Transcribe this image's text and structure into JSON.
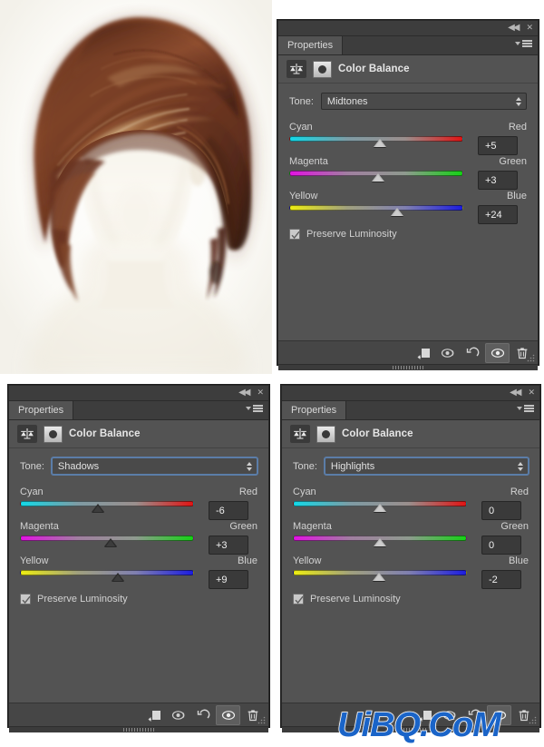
{
  "artwork": {
    "name": "hair-painting-artwork",
    "description": "Digital painting of auburn short hair on a faceless head",
    "colors": {
      "hair_dark": "#4a2418",
      "hair_mid": "#8a4b2e",
      "hair_light": "#d79a63",
      "hair_highlight": "#f2d6a8",
      "skin": "#f6f2ea",
      "background": "#ffffff"
    }
  },
  "watermark": {
    "text": "UiBQ.CoM",
    "color": "#1a64c8"
  },
  "panel_common": {
    "tab_label": "Properties",
    "adjustment_title": "Color Balance",
    "tone_label": "Tone:",
    "preserve_luminosity_label": "Preserve Luminosity",
    "preserve_luminosity_checked": true,
    "sliders": {
      "cyan_red": {
        "left": "Cyan",
        "right": "Red"
      },
      "magenta_green": {
        "left": "Magenta",
        "right": "Green"
      },
      "yellow_blue": {
        "left": "Yellow",
        "right": "Blue"
      }
    },
    "window_buttons": {
      "collapse": "◀◀",
      "close": "✕"
    },
    "footer_buttons": [
      {
        "name": "clip-to-layer-icon",
        "title": "Clip to Layer"
      },
      {
        "name": "view-previous-state-icon",
        "title": "View Previous State"
      },
      {
        "name": "reset-icon",
        "title": "Reset"
      },
      {
        "name": "toggle-visibility-icon",
        "title": "Toggle Layer Visibility"
      },
      {
        "name": "delete-icon",
        "title": "Delete Adjustment Layer"
      }
    ]
  },
  "panels": [
    {
      "id": "midtones",
      "tone_value": "Midtones",
      "tone_focused": false,
      "thumb_style": "light",
      "values": {
        "cyan_red": "+5",
        "magenta_green": "+3",
        "yellow_blue": "+24"
      },
      "slider_percent": {
        "cyan_red": 52,
        "magenta_green": 51,
        "yellow_blue": 62
      },
      "active_footer_index": 3
    },
    {
      "id": "shadows",
      "tone_value": "Shadows",
      "tone_focused": true,
      "thumb_style": "dark",
      "values": {
        "cyan_red": "-6",
        "magenta_green": "+3",
        "yellow_blue": "+9"
      },
      "slider_percent": {
        "cyan_red": 45,
        "magenta_green": 52,
        "yellow_blue": 56
      },
      "active_footer_index": 3
    },
    {
      "id": "highlights",
      "tone_value": "Highlights",
      "tone_focused": true,
      "thumb_style": "light",
      "values": {
        "cyan_red": "0",
        "magenta_green": "0",
        "yellow_blue": "-2"
      },
      "slider_percent": {
        "cyan_red": 50,
        "magenta_green": 50,
        "yellow_blue": 50
      },
      "active_footer_index": 3
    }
  ]
}
